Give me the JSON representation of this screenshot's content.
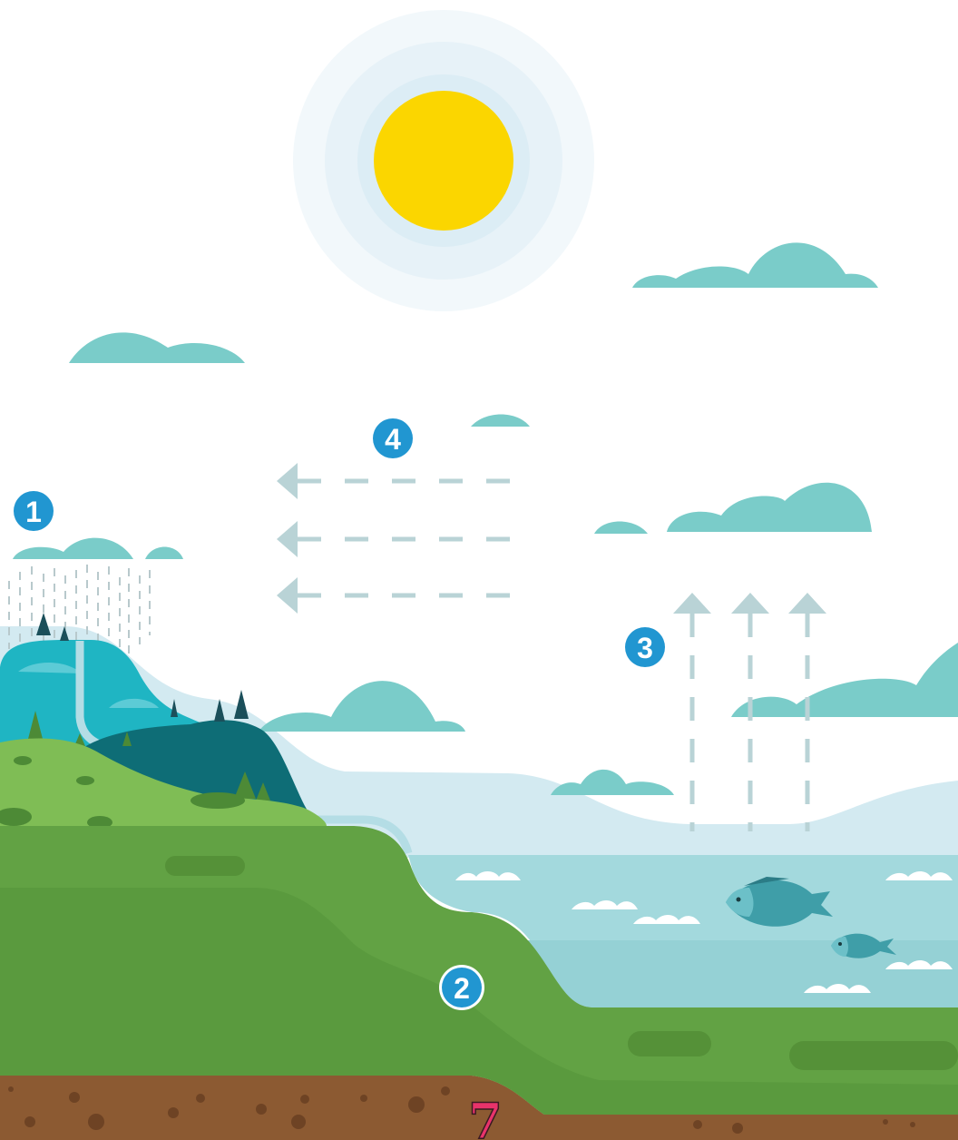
{
  "diagram": {
    "labels": {
      "rain": "1",
      "groundwater": "2",
      "evaporation": "3",
      "wind": "4",
      "soil_marker": "7"
    },
    "colors": {
      "sun": "#fbd600",
      "sun_halo": "#e6f1f8",
      "cloud": "#7accc9",
      "mountain": "#1fb5c3",
      "forest_hill": "#0e6d76",
      "grass": "#62a244",
      "grass_light": "#7fbd55",
      "sea": "#a0d8dc",
      "soil": "#8c5a32",
      "badge": "#2196d1",
      "arrow": "#b9d3d6",
      "marker": "#e8336b"
    },
    "icons": [
      "sun-icon",
      "cloud-icon",
      "rain-icon",
      "fish-icon",
      "tree-icon",
      "arrow-icon"
    ]
  }
}
